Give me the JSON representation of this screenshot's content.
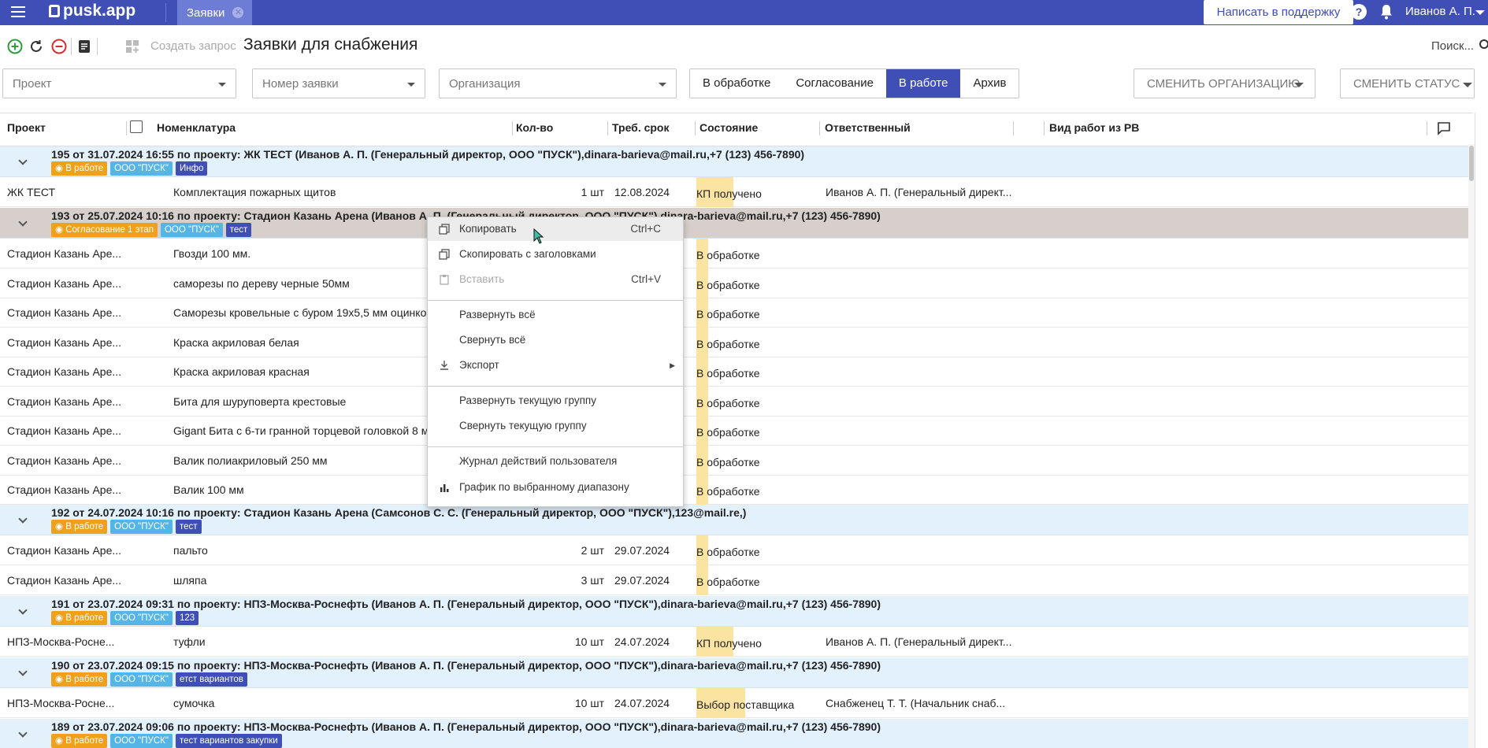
{
  "topbar": {
    "logo": "pusk.app",
    "tab_label": "Заявки",
    "support_label": "Написать в поддержку",
    "help": "?",
    "user": "Иванов А. П."
  },
  "toolbar": {
    "create_request": "Создать запрос",
    "title": "Заявки для снабжения",
    "search": "Поиск..."
  },
  "filters": {
    "project": "Проект",
    "request_number": "Номер заявки",
    "organization": "Организация",
    "segments": [
      "В обработке",
      "Согласование",
      "В работе",
      "Архив"
    ],
    "active_segment": "В работе",
    "change_org": "СМЕНИТЬ ОРГАНИЗАЦИЮ",
    "change_status": "СМЕНИТЬ СТАТУС"
  },
  "grid": {
    "columns": [
      "Проект",
      "Номенклатура",
      "Кол-во",
      "Треб. срок",
      "Состояние",
      "Ответственный",
      "Вид работ из РВ"
    ],
    "groups": [
      {
        "title": "195 от 31.07.2024 16:55 по проекту: ЖК ТЕСТ (Иванов А. П. (Генеральный директор, ООО \"ПУСК\"),dinara-barieva@mail.ru,+7 (123) 456-7890)",
        "tags": [
          {
            "text": "В работе",
            "kind": "work"
          },
          {
            "text": "ООО \"ПУСК\"",
            "kind": "org"
          },
          {
            "text": "Инфо",
            "kind": "info"
          }
        ],
        "rows": [
          {
            "project": "ЖК ТЕСТ",
            "item": "Комплектация пожарных щитов",
            "qty": "1 шт",
            "due": "12.08.2024",
            "state": "КП получено",
            "resp": "Иванов А. П. (Генеральный директ..."
          }
        ]
      },
      {
        "title": "193 от 25.07.2024 10:16 по проекту: Стадион Казань Арена (Иванов А. П. (Генеральный директор, ООО \"ПУСК\"),dinara-barieva@mail.ru,+7 (123) 456-7890)",
        "tags": [
          {
            "text": "Согласование 1 этап",
            "kind": "appr"
          },
          {
            "text": "ООО \"ПУСК\"",
            "kind": "org"
          },
          {
            "text": "тест",
            "kind": "info"
          }
        ],
        "rows": [
          {
            "project": "Стадион Казань Аре...",
            "item": "Гвозди 100 мм.",
            "qty": "",
            "due": "",
            "state": "В обработке",
            "resp": ""
          },
          {
            "project": "Стадион Казань Аре...",
            "item": "саморезы по дереву черные 50мм",
            "qty": "",
            "due": "",
            "state": "В обработке",
            "resp": ""
          },
          {
            "project": "Стадион Казань Аре...",
            "item": "Саморезы кровельные с буром 19х5,5 мм оцинко",
            "qty": "",
            "due": "",
            "state": "В обработке",
            "resp": ""
          },
          {
            "project": "Стадион Казань Аре...",
            "item": "Краска акриловая белая",
            "qty": "",
            "due": "",
            "state": "В обработке",
            "resp": ""
          },
          {
            "project": "Стадион Казань Аре...",
            "item": "Краска акриловая красная",
            "qty": "",
            "due": "",
            "state": "В обработке",
            "resp": ""
          },
          {
            "project": "Стадион Казань Аре...",
            "item": "Бита для шуруповерта крестовые",
            "qty": "",
            "due": "",
            "state": "В обработке",
            "resp": ""
          },
          {
            "project": "Стадион Казань Аре...",
            "item": "Gigant Бита с 6-ти гранной торцевой головкой 8 м",
            "qty": "",
            "due": "",
            "state": "В обработке",
            "resp": ""
          },
          {
            "project": "Стадион Казань Аре...",
            "item": "Валик полиакриловый 250 мм",
            "qty": "",
            "due": "",
            "state": "В обработке",
            "resp": ""
          },
          {
            "project": "Стадион Казань Аре...",
            "item": "Валик 100 мм",
            "qty": "",
            "due": "",
            "state": "В обработке",
            "resp": ""
          }
        ]
      },
      {
        "title": "192 от 24.07.2024 10:16 по проекту: Стадион Казань Арена (Самсонов С. С. (Генеральный директор, ООО \"ПУСК\"),123@mail.re,)",
        "tags": [
          {
            "text": "В работе",
            "kind": "work"
          },
          {
            "text": "ООО \"ПУСК\"",
            "kind": "org"
          },
          {
            "text": "тест",
            "kind": "info"
          }
        ],
        "rows": [
          {
            "project": "Стадион Казань Аре...",
            "item": "пальто",
            "qty": "2 шт",
            "due": "29.07.2024",
            "state": "В обработке",
            "resp": ""
          },
          {
            "project": "Стадион Казань Аре...",
            "item": "шляпа",
            "qty": "3 шт",
            "due": "29.07.2024",
            "state": "В обработке",
            "resp": ""
          }
        ]
      },
      {
        "title": "191 от 23.07.2024 09:31 по проекту: НПЗ-Москва-Роснефть (Иванов А. П. (Генеральный директор, ООО \"ПУСК\"),dinara-barieva@mail.ru,+7 (123) 456-7890)",
        "tags": [
          {
            "text": "В работе",
            "kind": "work"
          },
          {
            "text": "ООО \"ПУСК\"",
            "kind": "org"
          },
          {
            "text": "123",
            "kind": "info"
          }
        ],
        "rows": [
          {
            "project": "НПЗ-Москва-Росне...",
            "item": "туфли",
            "qty": "10 шт",
            "due": "24.07.2024",
            "state": "КП получено",
            "resp": "Иванов А. П. (Генеральный директ..."
          }
        ]
      },
      {
        "title": "190 от 23.07.2024 09:15 по проекту: НПЗ-Москва-Роснефть (Иванов А. П. (Генеральный директор, ООО \"ПУСК\"),dinara-barieva@mail.ru,+7 (123) 456-7890)",
        "tags": [
          {
            "text": "В работе",
            "kind": "work"
          },
          {
            "text": "ООО \"ПУСК\"",
            "kind": "org"
          },
          {
            "text": "етст вариантов",
            "kind": "info"
          }
        ],
        "rows": [
          {
            "project": "НПЗ-Москва-Росне...",
            "item": "сумочка",
            "qty": "10 шт",
            "due": "24.07.2024",
            "state": "Выбор поставщика",
            "resp": "Снабженец Т. Т. (Начальник снаб..."
          }
        ]
      },
      {
        "title": "189 от 23.07.2024 09:06 по проекту: НПЗ-Москва-Роснефть (Иванов А. П. (Генеральный директор, ООО \"ПУСК\"),dinara-barieva@mail.ru,+7 (123) 456-7890)",
        "tags": [
          {
            "text": "В работе",
            "kind": "work"
          },
          {
            "text": "ООО \"ПУСК\"",
            "kind": "org"
          },
          {
            "text": "тест вариантов закупки",
            "kind": "info"
          }
        ],
        "rows": []
      }
    ]
  },
  "context_menu": {
    "items": [
      {
        "label": "Копировать",
        "shortcut": "Ctrl+C",
        "icon": "copy-icon",
        "hover": true
      },
      {
        "label": "Скопировать с заголовками",
        "shortcut": "",
        "icon": "copy-icon"
      },
      {
        "label": "Вставить",
        "shortcut": "Ctrl+V",
        "icon": "paste-icon",
        "disabled": true
      },
      {
        "label": "Развернуть всё",
        "shortcut": "",
        "icon": ""
      },
      {
        "label": "Свернуть всё",
        "shortcut": "",
        "icon": ""
      },
      {
        "label": "Экспорт",
        "shortcut": "",
        "icon": "download-icon",
        "submenu": true
      },
      {
        "label": "Развернуть текущую группу",
        "shortcut": "",
        "icon": ""
      },
      {
        "label": "Свернуть текущую группу",
        "shortcut": "",
        "icon": ""
      },
      {
        "label": "Журнал действий пользователя",
        "shortcut": "",
        "icon": ""
      },
      {
        "label": "График по выбранному диапазону",
        "shortcut": "",
        "icon": "bar-chart-icon"
      }
    ]
  },
  "colors": {
    "primary": "#3f4fb5",
    "group_bg": "#e3f1fd",
    "selected_group_bg": "#d6cfcb",
    "state_highlight": "#fbe3a1",
    "tag_work": "#f0a01a",
    "tag_org": "#55b5e6",
    "tag_info": "#3f4fb5"
  }
}
